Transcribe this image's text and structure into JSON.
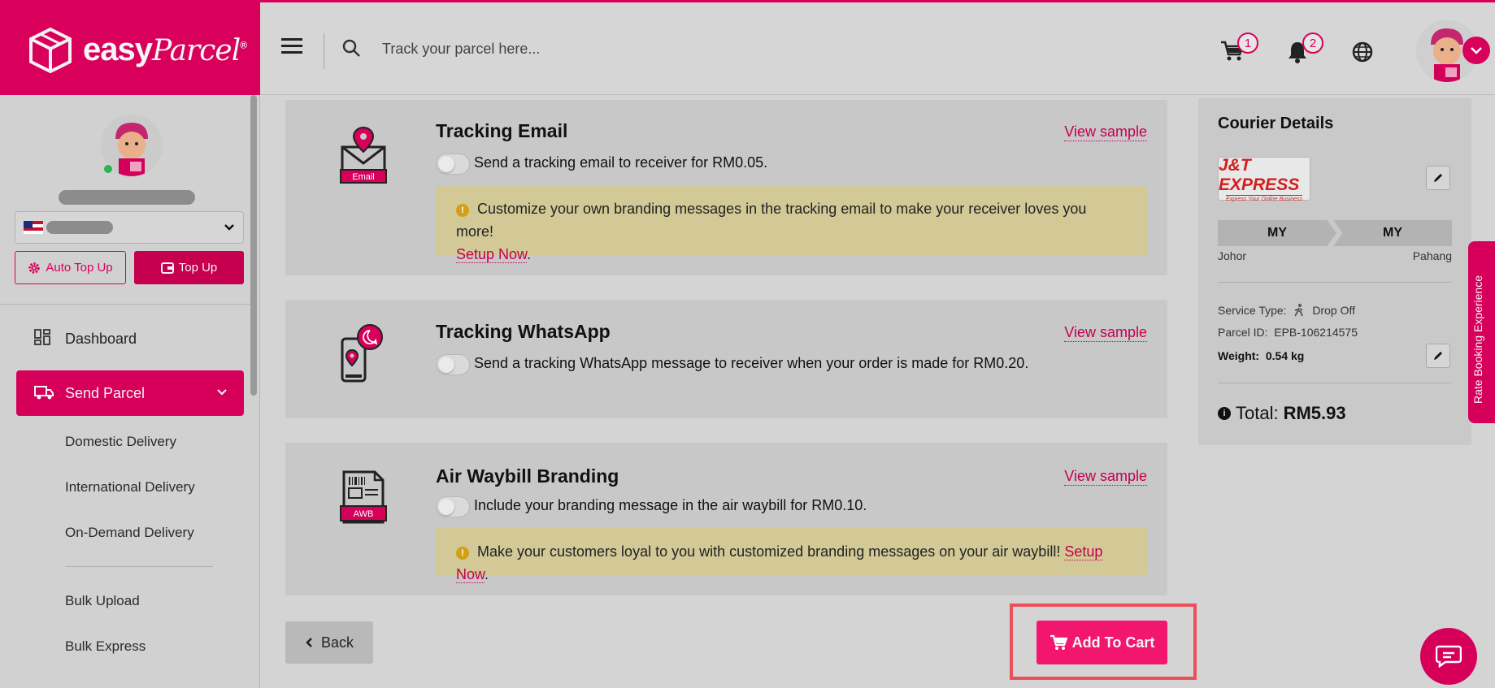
{
  "header": {
    "brand": "easy",
    "brand_script": "Parcel",
    "brand_mark": "®",
    "search_placeholder": "Track your parcel here...",
    "cart_count": "1",
    "notification_count": "2"
  },
  "sidebar": {
    "auto_topup_label": "Auto Top Up",
    "topup_label": "Top Up",
    "nav": {
      "dashboard": "Dashboard",
      "send_parcel": "Send Parcel"
    },
    "sub_items": [
      "Domestic Delivery",
      "International Delivery",
      "On-Demand Delivery",
      "Bulk Upload",
      "Bulk Express"
    ]
  },
  "addons": [
    {
      "title": "Tracking Email",
      "icon_caption": "Email",
      "view_sample": "View sample",
      "toggle_label": "Send a tracking email to receiver for RM0.05.",
      "note_text": "Customize your own branding messages in the tracking email to make your receiver loves you more!",
      "note_link": "Setup Now",
      "note_tail": "."
    },
    {
      "title": "Tracking WhatsApp",
      "view_sample": "View sample",
      "toggle_label": "Send a tracking WhatsApp message to receiver when your order is made for RM0.20."
    },
    {
      "title": "Air Waybill Branding",
      "icon_caption": "AWB",
      "view_sample": "View sample",
      "toggle_label": "Include your branding message in the air waybill for RM0.10.",
      "note_text": "Make your customers loyal to you with customized branding messages on your air waybill!",
      "note_link": "Setup Now",
      "note_tail": "."
    }
  ],
  "actions": {
    "back_label": "Back",
    "add_to_cart_label": "Add To Cart"
  },
  "courier": {
    "title": "Courier Details",
    "logo_main": "J&T EXPRESS",
    "logo_sub": "Express Your Online Business",
    "from_country": "MY",
    "to_country": "MY",
    "from_state": "Johor",
    "to_state": "Pahang",
    "service_type_label": "Service Type:",
    "service_type_value": "Drop Off",
    "parcel_id_label": "Parcel ID:",
    "parcel_id_value": "EPB-106214575",
    "weight_label": "Weight:",
    "weight_value": "0.54 kg",
    "total_label": "Total:",
    "total_value": "RM5.93"
  },
  "feedback_tab": "Rate Booking Experience",
  "colors": {
    "brand": "#d9005c",
    "accent_button": "#f2166f",
    "note_bg": "#d2c997",
    "highlight": "#e8505b"
  }
}
